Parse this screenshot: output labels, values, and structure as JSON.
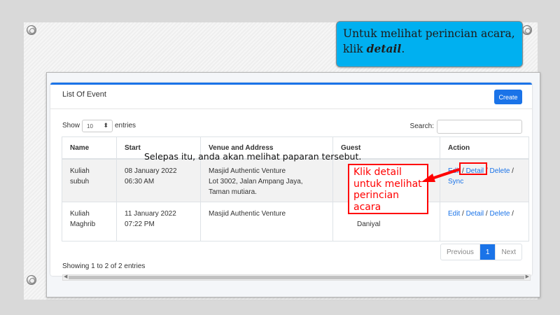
{
  "callout": {
    "line1": "Untuk melihat perincian acara,",
    "prefix": "klik ",
    "emph": "detail",
    "suffix": "."
  },
  "caption": "Selepas itu, anda akan melihat paparan tersebut.",
  "red_note": "Klik detail untuk melihat perincian acara",
  "card": {
    "title": "List Of Event",
    "create_label": "Create"
  },
  "controls": {
    "show": "Show",
    "page_size": "10",
    "entries": "entries",
    "search": "Search:"
  },
  "table": {
    "headers": [
      "Name",
      "Start",
      "Venue and Address",
      "Guest",
      "Action"
    ],
    "rows": [
      {
        "name": "Kuliah subuh",
        "start_date": "08 January 2022",
        "start_time": "06:30 AM",
        "venue": "Masjid Authentic Venture",
        "address": "Lot 3002, Jalan Ampang Jaya, Taman mutiara.",
        "guest": "",
        "edit": "Edit",
        "detail": "Detail",
        "delete": "Delete",
        "sync": "Sync"
      },
      {
        "name": "Kuliah Maghrib",
        "start_date": "11 January 2022",
        "start_time": "07:22 PM",
        "venue": "Masjid Authentic Venture",
        "address": "",
        "guest": "Daniyal",
        "edit": "Edit",
        "detail": "Detail",
        "delete": "Delete",
        "sync": ""
      }
    ]
  },
  "footer": {
    "info": "Showing 1 to 2 of 2 entries",
    "previous": "Previous",
    "page": "1",
    "next": "Next"
  },
  "colors": {
    "accent": "#1a73e8",
    "callout": "#00b0f0",
    "highlight": "#ff0000"
  }
}
